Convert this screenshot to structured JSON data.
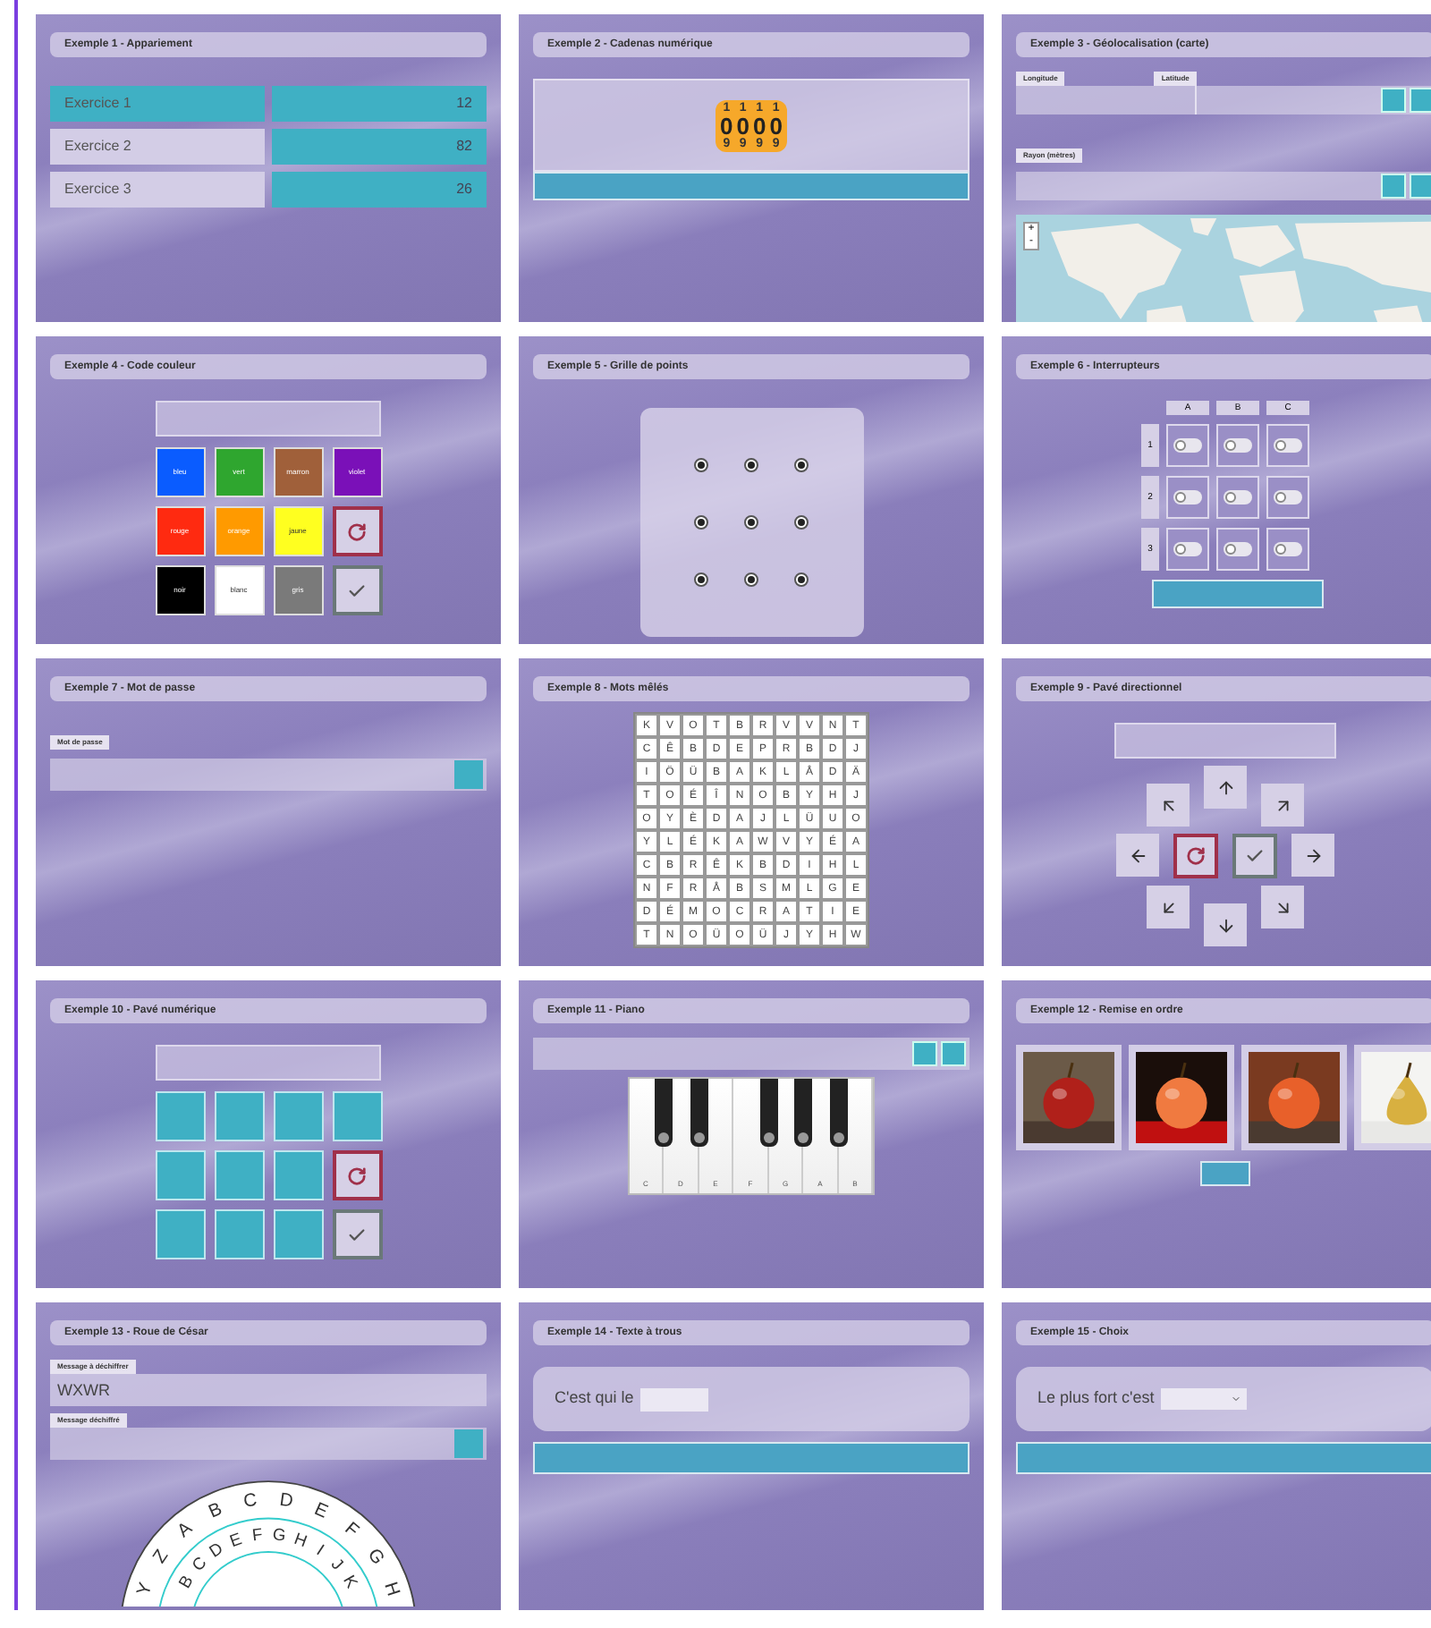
{
  "panels": [
    {
      "kind": "match",
      "title": "Exemple 1 - Appariement",
      "rows": [
        {
          "label": "Exercice 1",
          "value": "12",
          "selected": true
        },
        {
          "label": "Exercice 2",
          "value": "82",
          "selected": false
        },
        {
          "label": "Exercice 3",
          "value": "26",
          "selected": false
        }
      ]
    },
    {
      "kind": "lock",
      "title": "Exemple 2 - Cadenas numérique",
      "wheels": [
        {
          "above": "1",
          "value": "0",
          "below": "9"
        },
        {
          "above": "1",
          "value": "0",
          "below": "9"
        },
        {
          "above": "1",
          "value": "0",
          "below": "9"
        },
        {
          "above": "1",
          "value": "0",
          "below": "9"
        }
      ]
    },
    {
      "kind": "geo",
      "title": "Exemple 3 - Géolocalisation (carte)",
      "fields": [
        "Longitude",
        "Latitude"
      ],
      "radius_label": "Rayon (mètres)",
      "zoom_in": "+",
      "zoom_out": "-"
    },
    {
      "kind": "colors",
      "title": "Exemple 4 - Code couleur",
      "cells": [
        {
          "kind": "swatch",
          "label": "bleu",
          "color": "#0a5cff"
        },
        {
          "kind": "swatch",
          "label": "vert",
          "color": "#2fa62f"
        },
        {
          "kind": "swatch",
          "label": "marron",
          "color": "#a0603a"
        },
        {
          "kind": "swatch",
          "label": "violet",
          "color": "#7a10b8"
        },
        {
          "kind": "swatch",
          "label": "rouge",
          "color": "#ff2a10"
        },
        {
          "kind": "swatch",
          "label": "orange",
          "color": "#ff9a00"
        },
        {
          "kind": "swatch",
          "label": "jaune",
          "color": "#ffff20"
        },
        {
          "kind": "reset"
        },
        {
          "kind": "swatch",
          "label": "noir",
          "color": "#000000"
        },
        {
          "kind": "swatch",
          "label": "blanc",
          "color": "#ffffff"
        },
        {
          "kind": "swatch",
          "label": "gris",
          "color": "#7a7a7a"
        },
        {
          "kind": "check"
        }
      ]
    },
    {
      "kind": "dots",
      "title": "Exemple 5 - Grille de points",
      "points": [
        {
          "selected": false
        },
        {
          "selected": false
        },
        {
          "selected": false
        },
        {
          "selected": false
        },
        {
          "selected": false
        },
        {
          "selected": false
        },
        {
          "selected": false
        },
        {
          "selected": false
        },
        {
          "selected": false
        }
      ]
    },
    {
      "kind": "switches",
      "title": "Exemple 6 - Interrupteurs",
      "columns": [
        "A",
        "B",
        "C"
      ],
      "rows": [
        {
          "label": "1",
          "switches": [
            {
              "on": false
            },
            {
              "on": false
            },
            {
              "on": false
            }
          ]
        },
        {
          "label": "2",
          "switches": [
            {
              "on": false
            },
            {
              "on": false
            },
            {
              "on": false
            }
          ]
        },
        {
          "label": "3",
          "switches": [
            {
              "on": false
            },
            {
              "on": false
            },
            {
              "on": false
            }
          ]
        }
      ]
    },
    {
      "kind": "password",
      "title": "Exemple 7 - Mot de passe",
      "field_label": "Mot de passe"
    },
    {
      "kind": "wordsearch",
      "title": "Exemple 8 - Mots mêlés",
      "grid": [
        [
          "K",
          "V",
          "O",
          "T",
          "B",
          "R",
          "V",
          "V",
          "N",
          "T"
        ],
        [
          "C",
          "Ê",
          "B",
          "D",
          "E",
          "P",
          "R",
          "B",
          "D",
          "J"
        ],
        [
          "I",
          "Ö",
          "Ü",
          "B",
          "A",
          "K",
          "L",
          "Å",
          "D",
          "Ä"
        ],
        [
          "T",
          "O",
          "É",
          "Î",
          "N",
          "O",
          "B",
          "Y",
          "H",
          "J"
        ],
        [
          "O",
          "Y",
          "È",
          "D",
          "A",
          "J",
          "L",
          "Ü",
          "U",
          "O"
        ],
        [
          "Y",
          "L",
          "É",
          "K",
          "A",
          "W",
          "V",
          "Y",
          "É",
          "A"
        ],
        [
          "C",
          "B",
          "R",
          "Ê",
          "K",
          "B",
          "D",
          "I",
          "H",
          "L"
        ],
        [
          "N",
          "F",
          "R",
          "Å",
          "B",
          "S",
          "M",
          "L",
          "G",
          "E"
        ],
        [
          "D",
          "É",
          "M",
          "O",
          "C",
          "R",
          "A",
          "T",
          "I",
          "E"
        ],
        [
          "T",
          "N",
          "O",
          "Ü",
          "O",
          "Ü",
          "J",
          "Y",
          "H",
          "W"
        ]
      ]
    },
    {
      "kind": "dpad",
      "title": "Exemple 9 - Pavé directionnel",
      "rows": [
        [
          {
            "kind": "northwest"
          },
          {
            "kind": "north"
          },
          {
            "kind": "northeast"
          }
        ],
        [
          {
            "kind": "west"
          },
          {
            "kind": "reset"
          },
          {
            "kind": "check"
          },
          {
            "kind": "east"
          }
        ],
        [
          {
            "kind": "southwest"
          },
          {
            "kind": "south"
          },
          {
            "kind": "southeast"
          }
        ]
      ]
    },
    {
      "kind": "numpad",
      "title": "Exemple 10 - Pavé numérique",
      "cells": [
        {
          "kind": "key"
        },
        {
          "kind": "key"
        },
        {
          "kind": "key"
        },
        {
          "kind": "key"
        },
        {
          "kind": "key"
        },
        {
          "kind": "key"
        },
        {
          "kind": "key"
        },
        {
          "kind": "reset"
        },
        {
          "kind": "key"
        },
        {
          "kind": "key"
        },
        {
          "kind": "key"
        },
        {
          "kind": "check"
        }
      ]
    },
    {
      "kind": "piano",
      "title": "Exemple 11 - Piano",
      "keys": [
        "C",
        "D",
        "E",
        "F",
        "G",
        "A",
        "B"
      ]
    },
    {
      "kind": "order",
      "title": "Exemple 12 - Remise en ordre"
    },
    {
      "kind": "cesar",
      "title": "Exemple 13 - Roue de César",
      "field1_label": "Message à déchiffrer",
      "field1_value": "WXWR",
      "field2_label": "Message déchiffré",
      "outer": [
        "Y",
        "Z",
        "A",
        "B",
        "C",
        "D",
        "E",
        "F",
        "G",
        "H"
      ],
      "inner": [
        "B",
        "C",
        "D",
        "E",
        "F",
        "G",
        "H",
        "I",
        "J",
        "K"
      ]
    },
    {
      "kind": "cloze",
      "title": "Exemple 14 - Texte à trous",
      "text": "C'est qui le"
    },
    {
      "kind": "choice",
      "title": "Exemple 15 - Choix",
      "text": "Le plus fort c'est"
    }
  ]
}
